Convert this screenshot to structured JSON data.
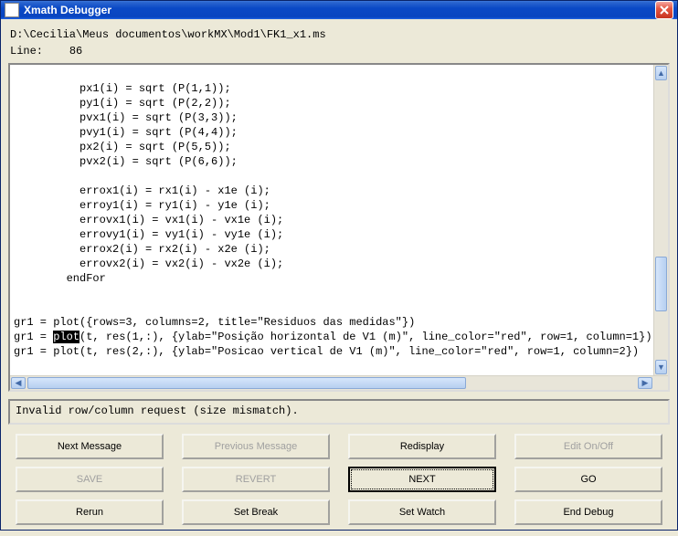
{
  "window": {
    "title": "Xmath Debugger"
  },
  "file": {
    "path": "D:\\Cecilia\\Meus documentos\\workMX\\Mod1\\FK1_x1.ms",
    "line_label": "Line:",
    "line_number": "86"
  },
  "code": {
    "pre1": "\n          px1(i) = sqrt (P(1,1));\n          py1(i) = sqrt (P(2,2));\n          pvx1(i) = sqrt (P(3,3));\n          pvy1(i) = sqrt (P(4,4));\n          px2(i) = sqrt (P(5,5));\n          pvx2(i) = sqrt (P(6,6));\n\n          errox1(i) = rx1(i) - x1e (i);\n          erroy1(i) = ry1(i) - y1e (i);\n          errovx1(i) = vx1(i) - vx1e (i);\n          errovy1(i) = vy1(i) - vy1e (i);\n          errox2(i) = rx2(i) - x2e (i);\n          errovx2(i) = vx2(i) - vx2e (i);\n        endFor\n\n\ngr1 = plot({rows=3, columns=2, title=\"Residuos das medidas\"})\ngr1 = ",
    "highlight": "plot",
    "post1": "(t, res(1,:), {ylab=\"Posição horizontal de V1 (m)\", line_color=\"red\", row=1, column=1})\ngr1 = plot(t, res(2,:), {ylab=\"Posicao vertical de V1 (m)\", line_color=\"red\", row=1, column=2})"
  },
  "message": {
    "text": "Invalid row/column request (size mismatch)."
  },
  "buttons": {
    "next_message": "Next Message",
    "previous_message": "Previous Message",
    "redisplay": "Redisplay",
    "edit_onoff": "Edit On/Off",
    "save": "SAVE",
    "revert": "REVERT",
    "next": "NEXT",
    "go": "GO",
    "rerun": "Rerun",
    "set_break": "Set Break",
    "set_watch": "Set Watch",
    "end_debug": "End Debug"
  }
}
